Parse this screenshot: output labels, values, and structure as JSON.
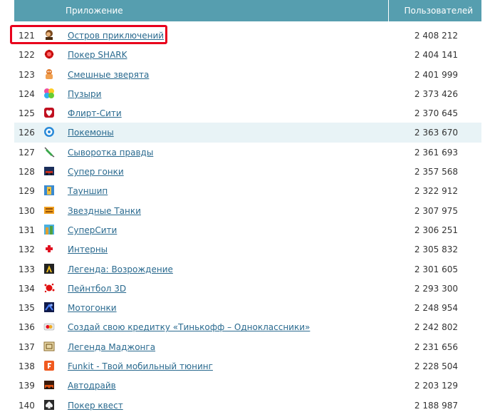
{
  "header": {
    "app_col": "Приложение",
    "users_col": "Пользователей"
  },
  "colors": {
    "header_bg": "#569eaf",
    "link": "#2a6a8f",
    "selection": "#e8001c",
    "row_highlight": "#e8f3f6"
  },
  "rows": [
    {
      "rank": "121",
      "name": "Остров приключений",
      "users": "2 408 212",
      "icon": "adventure-island-icon"
    },
    {
      "rank": "122",
      "name": "Покер SHARK",
      "users": "2 404 141",
      "icon": "poker-shark-icon"
    },
    {
      "rank": "123",
      "name": "Смешные зверята",
      "users": "2 401 999",
      "icon": "funny-animals-icon"
    },
    {
      "rank": "124",
      "name": "Пузыри",
      "users": "2 373 426",
      "icon": "bubbles-icon"
    },
    {
      "rank": "125",
      "name": "Флирт-Сити",
      "users": "2 370 645",
      "icon": "heart-icon"
    },
    {
      "rank": "126",
      "name": "Покемоны",
      "users": "2 363 670",
      "icon": "pokemon-icon"
    },
    {
      "rank": "127",
      "name": "Сыворотка правды",
      "users": "2 361 693",
      "icon": "syringe-icon"
    },
    {
      "rank": "128",
      "name": "Супер гонки",
      "users": "2 357 568",
      "icon": "race-car-icon"
    },
    {
      "rank": "129",
      "name": "Тауншип",
      "users": "2 322 912",
      "icon": "township-icon"
    },
    {
      "rank": "130",
      "name": "Звездные Танки",
      "users": "2 307 975",
      "icon": "star-tanks-icon"
    },
    {
      "rank": "131",
      "name": "СуперСити",
      "users": "2 306 251",
      "icon": "supercity-icon"
    },
    {
      "rank": "132",
      "name": "Интерны",
      "users": "2 305 832",
      "icon": "medical-cross-icon"
    },
    {
      "rank": "133",
      "name": "Легенда: Возрождение",
      "users": "2 301 605",
      "icon": "legend-rebirth-icon"
    },
    {
      "rank": "134",
      "name": "Пейнтбол 3D",
      "users": "2 293 300",
      "icon": "paint-splat-icon"
    },
    {
      "rank": "135",
      "name": "Мотогонки",
      "users": "2 248 954",
      "icon": "moto-race-icon"
    },
    {
      "rank": "136",
      "name": "Создай свою кредитку «Тинькофф – Одноклассники»",
      "users": "2 242 802",
      "icon": "credit-card-icon"
    },
    {
      "rank": "137",
      "name": "Легенда Маджонга",
      "users": "2 231 656",
      "icon": "mahjong-icon"
    },
    {
      "rank": "138",
      "name": "Funkit - Твой мобильный тюнинг",
      "users": "2 228 504",
      "icon": "funkit-icon"
    },
    {
      "rank": "139",
      "name": "Автодрайв",
      "users": "2 203 129",
      "icon": "autodrive-icon"
    },
    {
      "rank": "140",
      "name": "Покер квест",
      "users": "2 188 987",
      "icon": "poker-quest-icon"
    }
  ]
}
